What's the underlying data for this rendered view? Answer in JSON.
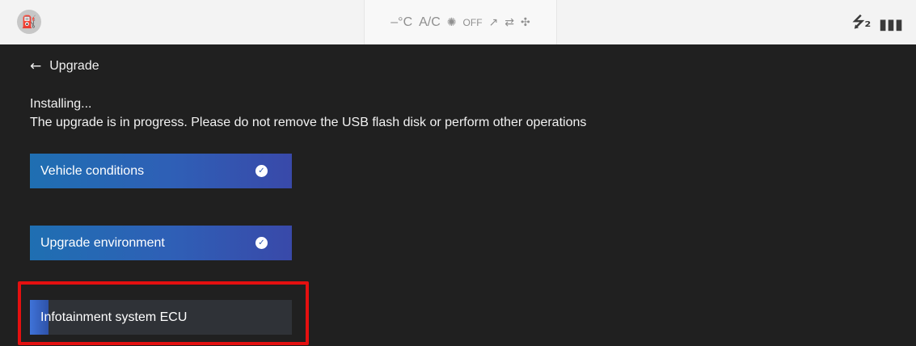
{
  "status_bar": {
    "left_icon": "fuel-gauge-icon",
    "climate": {
      "temperature": "–°C",
      "ac_label": "A/C",
      "fan_label": "OFF",
      "fan_icon": "fan-icon",
      "airflow_icon": "airflow-icon",
      "recirculation_icon": "recirculation-icon",
      "seat_icon": "seat-heat-icon"
    },
    "usb_label": "⭍₂",
    "signal_label": "ᴸᴳııll"
  },
  "nav": {
    "back_label": "Upgrade"
  },
  "status": {
    "title": "Installing...",
    "description": "The upgrade is in progress. Please do not remove the USB flash disk or perform other operations"
  },
  "steps": [
    {
      "label": "Vehicle conditions",
      "state": "done"
    },
    {
      "label": "Upgrade environment",
      "state": "done"
    },
    {
      "label": "Infotainment system ECU",
      "state": "in-progress",
      "progress": 0.07
    }
  ],
  "colors": {
    "accent": "#2f5fb6",
    "highlight": "#e41010"
  }
}
